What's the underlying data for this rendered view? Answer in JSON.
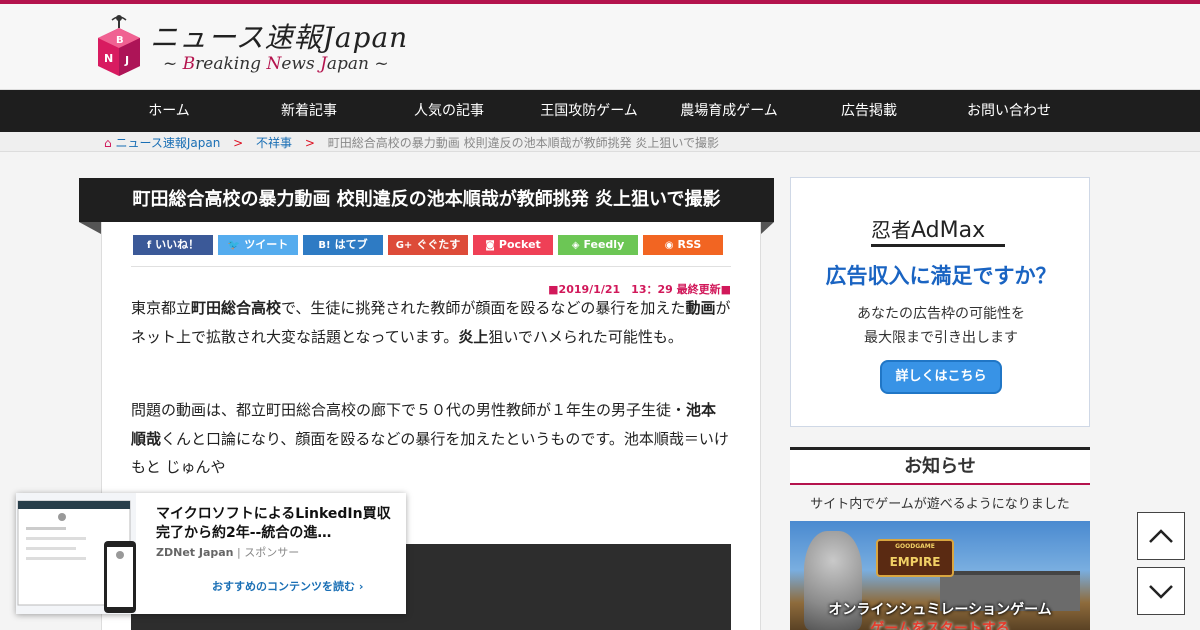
{
  "site": {
    "title": "ニュース速報Japan",
    "subtitle_prefix": "~ ",
    "subtitle_b": "B",
    "subtitle_reaking": "reaking ",
    "subtitle_n": "N",
    "subtitle_ews": "ews ",
    "subtitle_j": "J",
    "subtitle_apan": "apan",
    "subtitle_suffix": " ~",
    "logo_letters": [
      "B",
      "N",
      "J"
    ]
  },
  "nav": {
    "items": [
      "ホーム",
      "新着記事",
      "人気の記事",
      "王国攻防ゲーム",
      "農場育成ゲーム",
      "広告掲載",
      "お問い合わせ"
    ]
  },
  "breadcrumb": {
    "home": "ニュース速報Japan",
    "separator": ">",
    "category": "不祥事",
    "current": "町田総合高校の暴力動画 校則違反の池本順哉が教師挑発 炎上狙いで撮影"
  },
  "article": {
    "title": "町田総合高校の暴力動画 校則違反の池本順哉が教師挑発 炎上狙いで撮影",
    "share": [
      {
        "label": "いいね！",
        "icon": "f",
        "color": "#3b5998"
      },
      {
        "label": "ツイート",
        "icon": "🐦",
        "color": "#55acee"
      },
      {
        "label": "はてブ",
        "icon": "B!",
        "color": "#2e7bc4"
      },
      {
        "label": "ぐぐたす",
        "icon": "G+",
        "color": "#dd4b39"
      },
      {
        "label": "Pocket",
        "icon": "◙",
        "color": "#ef4056"
      },
      {
        "label": "Feedly",
        "icon": "◈",
        "color": "#6cc655"
      },
      {
        "label": "RSS",
        "icon": "◉",
        "color": "#f26522"
      }
    ],
    "date": "■2019/1/21　13：29 最終更新■",
    "p1": {
      "a": "東京都立",
      "b": "町田総合高校",
      "c": "で、生徒に挑発された教師が顔面を殴るなどの暴行を加えた",
      "d": "動画",
      "e": "がネット上で拡散され大変な話題となっています。",
      "f": "炎上",
      "g": "狙いでハメられた可能性も。"
    },
    "p2": {
      "a": "問題の動画は、都立町田総合高校の廊下で５０代の男性教師が１年生の男子生徒・",
      "b": "池本順哉",
      "c": "くんと口論になり、顔面を殴るなどの暴行を加えたというものです。池本順哉＝いけもと じゅんや"
    }
  },
  "ad": {
    "logo_a": "忍者",
    "logo_b": "AdMax",
    "headline": "広告収入に満足ですか？",
    "body_line1": "あなたの広告枠の可能性を",
    "body_line2": "最大限まで引き出します",
    "button": "詳しくはこちら"
  },
  "notice": {
    "heading": "お知らせ",
    "text": "サイト内でゲームが遊べるようになりました",
    "banner_brand": "GOODGAME",
    "banner_title": "EMPIRE",
    "banner_line1": "オンラインシュミレーションゲーム",
    "banner_line2": "ゲームをスタートする"
  },
  "recommend": {
    "title": "マイクロソフトによるLinkedIn買収完了から約2年--統合の進…",
    "source": "ZDNet Japan",
    "sponsor": " | スポンサー",
    "link": "おすすめのコンテンツを読む ›"
  },
  "scroll": {
    "up_icon": "chevron-up-icon",
    "down_icon": "chevron-down-icon"
  }
}
